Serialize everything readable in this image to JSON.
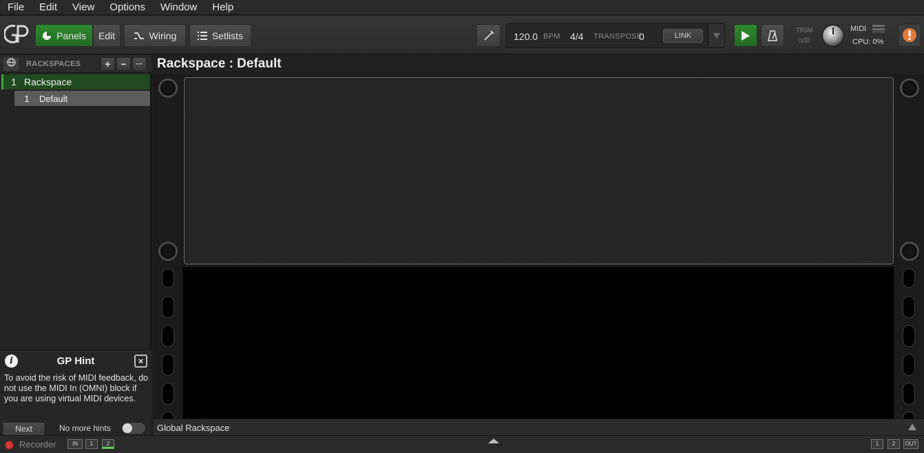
{
  "menu": [
    "File",
    "Edit",
    "View",
    "Options",
    "Window",
    "Help"
  ],
  "toolbar": {
    "panels_label": "Panels",
    "edit_label": "Edit",
    "wiring_label": "Wiring",
    "setlists_label": "Setlists",
    "bpm_value": "120.0",
    "bpm_label": "BPM",
    "time_signature": "4/4",
    "transpose_label": "TRANSPOSE",
    "transpose_value": "0",
    "link_label": "LINK",
    "trim_label": "TRIM",
    "trim_value": "0dB",
    "midi_label": "MIDI",
    "cpu_label": "CPU:",
    "cpu_value": "0%",
    "accent_green": "#2f8a2f"
  },
  "rackspaces": {
    "header": "RACKSPACES",
    "add": "+",
    "remove": "−",
    "more": "···",
    "items": [
      {
        "number": "1",
        "name": "Rackspace",
        "variations": [
          {
            "number": "1",
            "name": "Default"
          }
        ]
      }
    ]
  },
  "hint": {
    "title": "GP Hint",
    "text": "To avoid the risk of MIDI feedback, do not use the MIDI In (OMNI) block if you are using virtual MIDI devices.",
    "next_label": "Next",
    "no_more_label": "No more hints",
    "close": "×",
    "info": "i"
  },
  "main": {
    "title": "Rackspace : Default",
    "global_label": "Global Rackspace"
  },
  "status": {
    "recorder_label": "Recorder",
    "in_meters": [
      "IN",
      "1",
      "2"
    ],
    "out_meters": [
      "1",
      "2",
      "OUT"
    ]
  }
}
